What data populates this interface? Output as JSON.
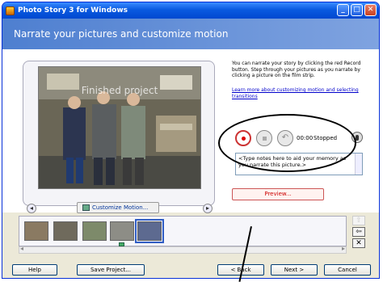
{
  "window": {
    "title": "Photo Story 3 for Windows",
    "min": "_",
    "max": "□",
    "close": "✕"
  },
  "banner": {
    "heading": "Narrate your pictures and customize motion"
  },
  "preview": {
    "caption": "Finished project",
    "customize_label": "Customize Motion...",
    "prev_arrow": "◂",
    "next_arrow": "▸"
  },
  "help": {
    "text": "You can narrate your story by clicking the red Record button. Step through your pictures as you narrate by clicking a picture on the film strip.",
    "link": "Learn more about customizing motion and selecting transitions"
  },
  "recorder": {
    "undo_glyph": "↶",
    "time": "00:00",
    "status": "Stopped"
  },
  "notes": {
    "placeholder": "<Type notes here to aid your memory as you narrate this picture.>"
  },
  "preview_button": {
    "label": "Preview..."
  },
  "filmstrip": {
    "thumbnails": [
      {
        "color": "#8a7a62"
      },
      {
        "color": "#6f6a5c"
      },
      {
        "color": "#7d8a6a"
      },
      {
        "color": "#8d8d86"
      },
      {
        "color": "#5d6a90"
      }
    ],
    "side_up": "⇧",
    "side_left": "⇦",
    "side_delete": "✕"
  },
  "footer": {
    "help": "Help",
    "save": "Save Project...",
    "back": "< Back",
    "next": "Next >",
    "cancel": "Cancel"
  },
  "colors": {
    "accent": "#0a5ae0",
    "record": "#d00000",
    "banner": "#4e7fd0"
  }
}
